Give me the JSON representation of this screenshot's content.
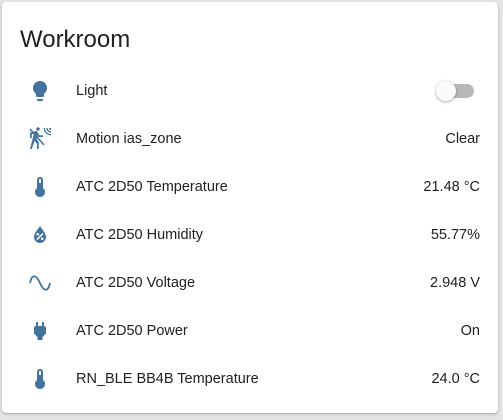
{
  "card": {
    "title": "Workroom",
    "icon_color": "#44739e",
    "entities": [
      {
        "icon": "lightbulb-icon",
        "name": "Light",
        "state": "off",
        "type": "toggle"
      },
      {
        "icon": "motion-sensor-icon",
        "name": "Motion ias_zone",
        "state": "Clear",
        "type": "text"
      },
      {
        "icon": "thermometer-icon",
        "name": "ATC 2D50 Temperature",
        "state": "21.48 °C",
        "type": "text"
      },
      {
        "icon": "water-percent-icon",
        "name": "ATC 2D50 Humidity",
        "state": "55.77%",
        "type": "text"
      },
      {
        "icon": "sine-wave-icon",
        "name": "ATC 2D50 Voltage",
        "state": "2.948 V",
        "type": "text"
      },
      {
        "icon": "power-plug-icon",
        "name": "ATC 2D50 Power",
        "state": "On",
        "type": "text"
      },
      {
        "icon": "thermometer-icon",
        "name": "RN_BLE BB4B Temperature",
        "state": "24.0 °C",
        "type": "text"
      }
    ]
  }
}
